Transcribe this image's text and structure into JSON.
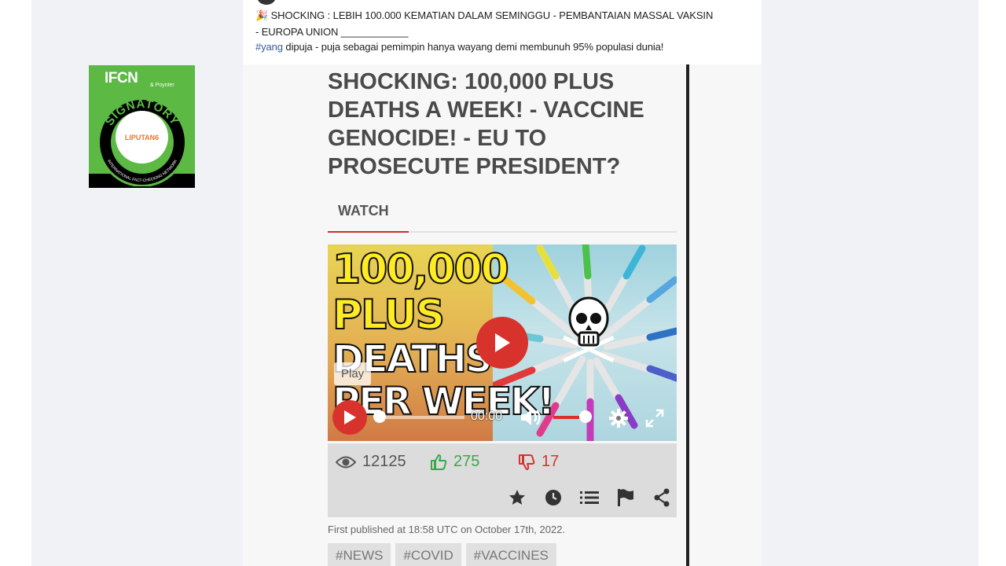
{
  "post": {
    "line1_emoji": "🎉",
    "line1": "SHOCKING : LEBIH 100.000 KEMATIAN DALAM SEMINGGU - PEMBANTAIAN MASSAL VAKSIN",
    "line2": "- EUROPA UNION ____________",
    "line3_hashtag": "#yang",
    "line3": " dipuja - puja sebagai pemimpin hanya wayang demi membunuh 95% populasi dunia!"
  },
  "badge": {
    "ifcn": "IFCN",
    "ifcn_sub": "& Poynter",
    "ring_text": "SIGNATORY",
    "ring_sub": "INTERNATIONAL FACT-CHECKING NETWORK",
    "logo_text": "LIPUTAN6"
  },
  "article": {
    "headline": "SHOCKING: 100,000 PLUS DEATHS A WEEK! - VACCINE GENOCIDE! - EU TO PROSECUTE PRESIDENT?",
    "tab_watch": "WATCH",
    "thumb_line1": "100,000",
    "thumb_line2": "PLUS",
    "thumb_line3": "DEATHS",
    "thumb_line4": "PER WEEK!",
    "play_tooltip": "Play",
    "time": "00:00",
    "views": "12125",
    "likes": "275",
    "dislikes": "17",
    "published": "First published at 18:58 UTC on October 17th, 2022.",
    "tags": [
      "#NEWS",
      "#COVID",
      "#VACCINES"
    ]
  },
  "colors": {
    "accent_red": "#d8322d",
    "like_green": "#3aa64c",
    "badge_green": "#5bb944"
  },
  "icons": {
    "views": "eye-icon",
    "likes": "thumbs-up-icon",
    "dislikes": "thumbs-down-icon",
    "actions": [
      "star-icon",
      "clock-icon",
      "list-icon",
      "flag-icon",
      "share-icon"
    ]
  }
}
